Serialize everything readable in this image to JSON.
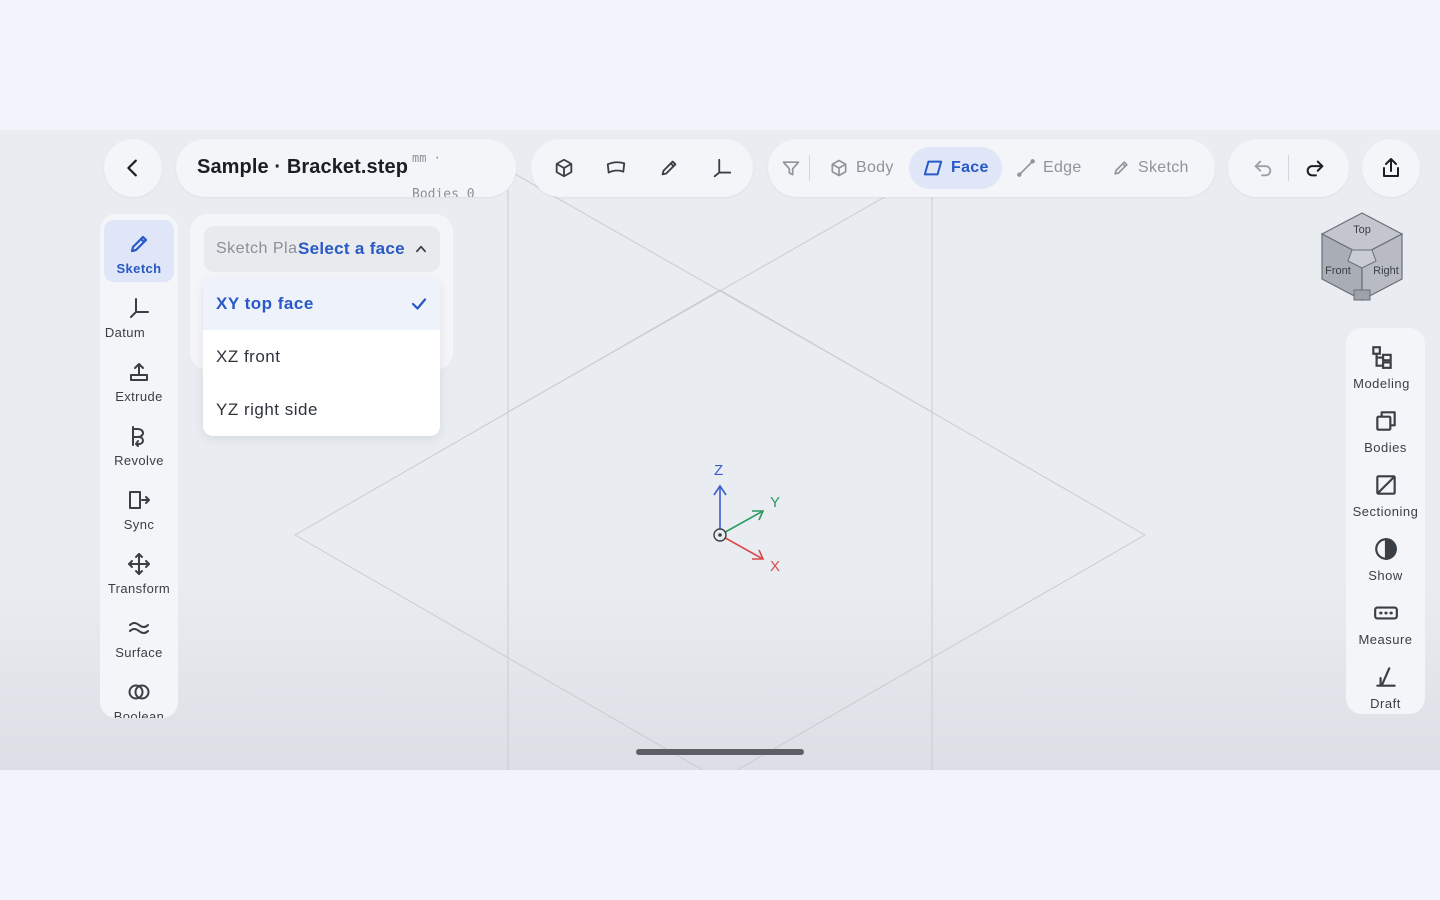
{
  "header": {
    "file_title": "Sample · Bracket.step",
    "unit_meta": "mm ·",
    "bodies_meta": "Bodies 0"
  },
  "filter": {
    "items": [
      {
        "label": "Body",
        "icon": "cube-outline-icon"
      },
      {
        "label": "Face",
        "icon": "face-parallelogram-icon",
        "active": true
      },
      {
        "label": "Edge",
        "icon": "edge-line-icon"
      },
      {
        "label": "Sketch",
        "icon": "pencil-icon"
      }
    ]
  },
  "left_tools": [
    {
      "label": "Sketch",
      "icon": "pencil-icon",
      "active": true
    },
    {
      "label": "Datum",
      "icon": "datum-axes-icon"
    },
    {
      "label": "Extrude",
      "icon": "extrude-icon"
    },
    {
      "label": "Revolve",
      "icon": "revolve-icon"
    },
    {
      "label": "Sync",
      "icon": "sync-icon"
    },
    {
      "label": "Transform",
      "icon": "move-icon"
    },
    {
      "label": "Surface",
      "icon": "surface-icon"
    },
    {
      "label": "Boolean",
      "icon": "boolean-icon"
    }
  ],
  "sketch_panel": {
    "plane_label": "Sketch Plane",
    "plane_value": "Select a face",
    "options": [
      {
        "label": "XY top face",
        "selected": true
      },
      {
        "label": "XZ front"
      },
      {
        "label": "YZ right side"
      }
    ]
  },
  "right_tools": [
    {
      "label": "Modeling",
      "icon": "modeling-tree-icon"
    },
    {
      "label": "Bodies",
      "icon": "bodies-icon"
    },
    {
      "label": "Sectioning",
      "icon": "section-icon"
    },
    {
      "label": "Show",
      "icon": "half-circle-icon"
    },
    {
      "label": "Measure",
      "icon": "ruler-icon"
    },
    {
      "label": "Draft",
      "icon": "draft-angle-icon"
    }
  ],
  "view_cube": {
    "top": "Top",
    "front": "Front",
    "right": "Right"
  },
  "axes": {
    "x": "X",
    "y": "Y",
    "z": "Z"
  },
  "colors": {
    "accent": "#2859c5",
    "active_bg": "#dfe6f7",
    "axis_x": "#d94a4a",
    "axis_y": "#2a9a62",
    "axis_z": "#3b5bd0"
  }
}
